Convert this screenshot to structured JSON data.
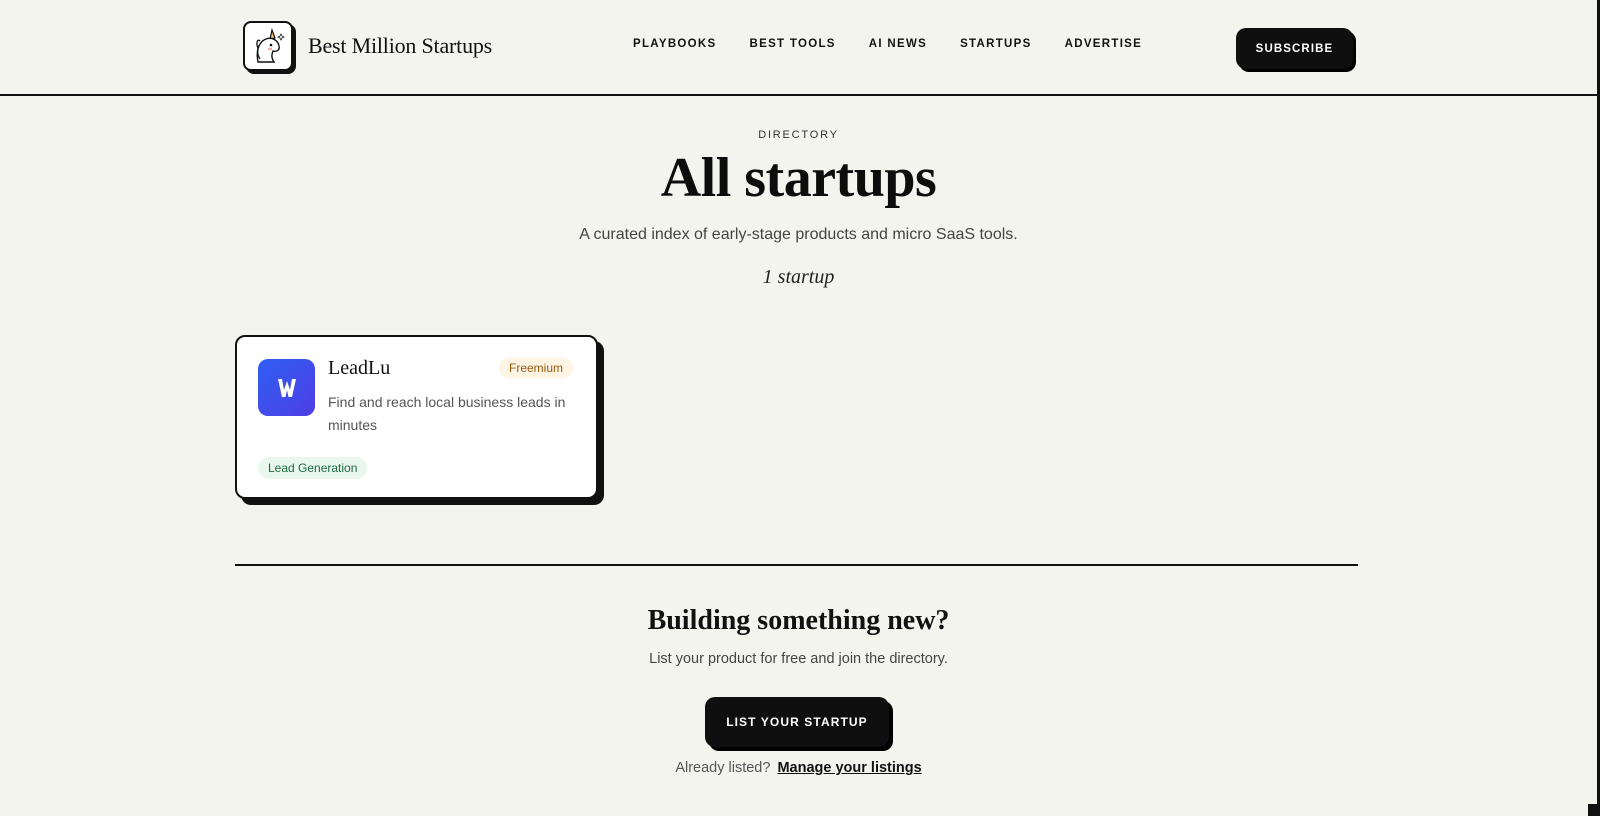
{
  "header": {
    "brand_name": "Best Million Startups",
    "logo_icon": "unicorn-icon",
    "nav": [
      {
        "label": "PLAYBOOKS"
      },
      {
        "label": "BEST TOOLS"
      },
      {
        "label": "AI NEWS"
      },
      {
        "label": "STARTUPS"
      },
      {
        "label": "ADVERTISE"
      }
    ],
    "subscribe_label": "SUBSCRIBE"
  },
  "hero": {
    "eyebrow": "DIRECTORY",
    "title": "All startups",
    "subtitle": "A curated index of early-stage products and micro SaaS tools.",
    "count": "1 startup"
  },
  "startups": [
    {
      "name": "LeadLu",
      "pricing": "Freemium",
      "description": "Find and reach local business leads in minutes",
      "category": "Lead Generation",
      "logo_icon": "leadlu-logo-icon",
      "logo_color": "#3b4ff0"
    }
  ],
  "cta": {
    "title": "Building something new?",
    "text": "List your product for free and join the directory.",
    "button_label": "LIST YOUR STARTUP",
    "already_text": "Already listed?",
    "manage_link": "Manage your listings"
  },
  "colors": {
    "background": "#f4f4ef",
    "ink": "#111111",
    "pricing_badge_bg": "#fdf4e4",
    "pricing_badge_text": "#9a5a10",
    "category_bg": "#e9f7ee",
    "category_text": "#1d6b40"
  }
}
